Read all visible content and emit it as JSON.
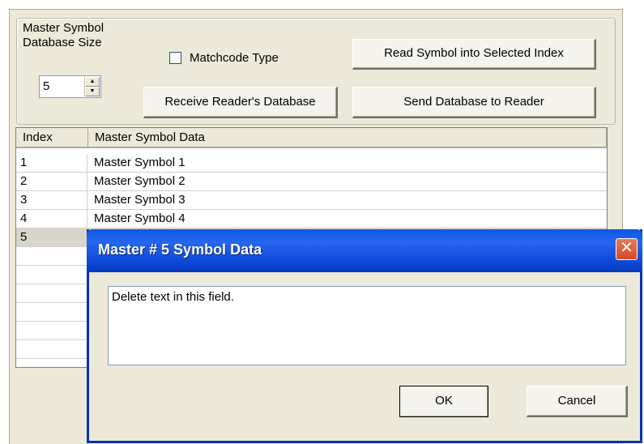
{
  "config": {
    "db_size_label_line1": "Master Symbol",
    "db_size_label_line2": "Database Size",
    "db_size_value": "5",
    "matchcode_label": "Matchcode Type",
    "matchcode_checked": false,
    "read_symbol_button": "Read Symbol into Selected Index",
    "receive_db_button": "Receive Reader's Database",
    "send_db_button": "Send Database to Reader"
  },
  "table": {
    "headers": [
      "Index",
      "Master Symbol Data"
    ],
    "rows": [
      {
        "index": "1",
        "data": "Master Symbol 1"
      },
      {
        "index": "2",
        "data": "Master Symbol 2"
      },
      {
        "index": "3",
        "data": "Master Symbol 3"
      },
      {
        "index": "4",
        "data": "Master Symbol 4"
      },
      {
        "index": "5",
        "data": ""
      }
    ],
    "selected_row": 5
  },
  "dialog": {
    "title": "Master # 5 Symbol Data",
    "field_value": "Delete text in this field.",
    "ok_label": "OK",
    "cancel_label": "Cancel"
  },
  "colors": {
    "titlebar": "#0a53e0",
    "panel_bg": "#ece9d8",
    "close_button": "#d6502c"
  },
  "icons": {
    "spin_up": "up-arrow-icon",
    "spin_down": "down-arrow-icon",
    "close": "close-icon"
  }
}
